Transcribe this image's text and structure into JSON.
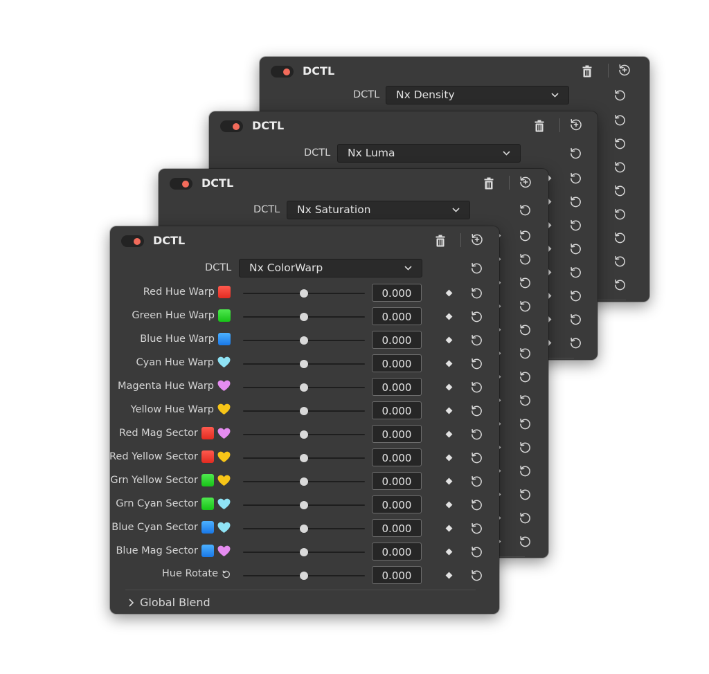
{
  "panels": [
    {
      "title": "DCTL",
      "field_label": "DCTL",
      "selected": "Nx Density"
    },
    {
      "title": "DCTL",
      "field_label": "DCTL",
      "selected": "Nx Luma"
    },
    {
      "title": "DCTL",
      "field_label": "DCTL",
      "selected": "Nx Saturation"
    },
    {
      "title": "DCTL",
      "field_label": "DCTL",
      "selected": "Nx ColorWarp"
    }
  ],
  "params": [
    {
      "label": "Red Hue Warp",
      "icons": [
        "red-square"
      ],
      "value": "0.000"
    },
    {
      "label": "Green Hue Warp",
      "icons": [
        "green-square"
      ],
      "value": "0.000"
    },
    {
      "label": "Blue Hue Warp",
      "icons": [
        "blue-square"
      ],
      "value": "0.000"
    },
    {
      "label": "Cyan Hue Warp",
      "icons": [
        "cyan-heart"
      ],
      "value": "0.000"
    },
    {
      "label": "Magenta Hue Warp",
      "icons": [
        "magenta-heart"
      ],
      "value": "0.000"
    },
    {
      "label": "Yellow Hue Warp",
      "icons": [
        "yellow-heart"
      ],
      "value": "0.000"
    },
    {
      "label": "Red Mag Sector",
      "icons": [
        "red-square",
        "magenta-heart"
      ],
      "value": "0.000"
    },
    {
      "label": "Red Yellow Sector",
      "icons": [
        "red-square",
        "yellow-heart"
      ],
      "value": "0.000"
    },
    {
      "label": "Grn Yellow Sector",
      "icons": [
        "green-square",
        "yellow-heart"
      ],
      "value": "0.000"
    },
    {
      "label": "Grn Cyan Sector",
      "icons": [
        "green-square",
        "cyan-heart"
      ],
      "value": "0.000"
    },
    {
      "label": "Blue Cyan Sector",
      "icons": [
        "blue-square",
        "cyan-heart"
      ],
      "value": "0.000"
    },
    {
      "label": "Blue Mag Sector",
      "icons": [
        "blue-square",
        "magenta-heart"
      ],
      "value": "0.000"
    },
    {
      "label": "Hue Rotate",
      "icons": [
        "rotate-symbol"
      ],
      "value": "0.000"
    }
  ],
  "slider_position": 0.5,
  "global_blend": "Global Blend",
  "colors": {
    "panel_bg": "#3a3a3a",
    "toggle_dot": "#f26b5b",
    "cyan_heart": "#8fe3f5",
    "magenta_heart": "#e58cf0",
    "yellow_heart": "#f7c518"
  }
}
